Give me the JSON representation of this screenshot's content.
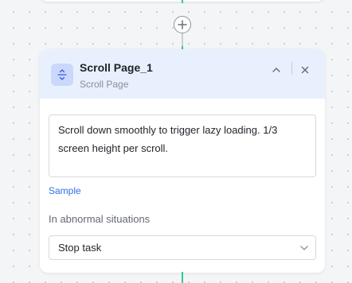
{
  "node": {
    "title": "Scroll Page_1",
    "subtitle": "Scroll Page",
    "icon": "scroll-vertical-icon",
    "accent_color": "#2ecc8f",
    "header_bg": "#e8f0fe",
    "description": "Scroll down smoothly to trigger lazy loading. 1/3 screen height per scroll.",
    "sample_link_text": "Sample"
  },
  "abnormal": {
    "label": "In abnormal situations",
    "selected": "Stop task"
  }
}
